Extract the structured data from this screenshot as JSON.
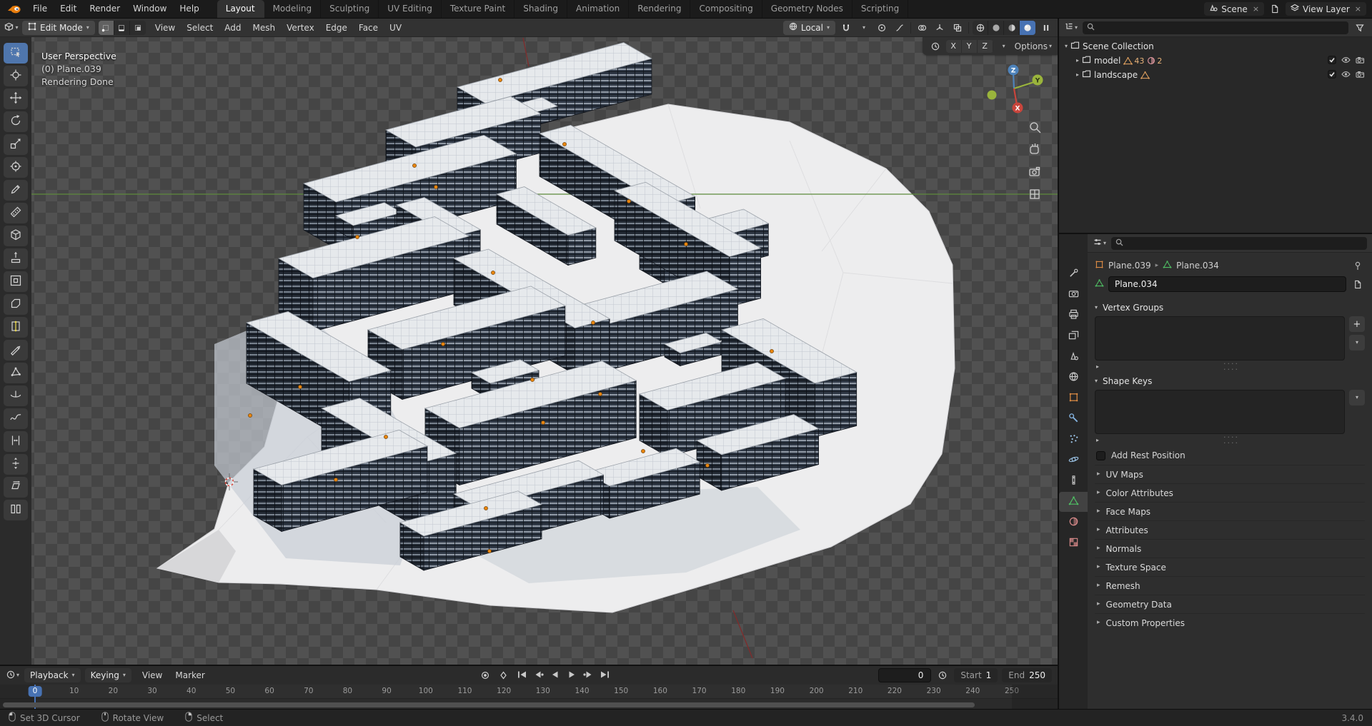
{
  "topbar": {
    "menus": [
      "File",
      "Edit",
      "Render",
      "Window",
      "Help"
    ],
    "workspaces": [
      "Layout",
      "Modeling",
      "Sculpting",
      "UV Editing",
      "Texture Paint",
      "Shading",
      "Animation",
      "Rendering",
      "Compositing",
      "Geometry Nodes",
      "Scripting"
    ],
    "active_workspace": "Layout",
    "scene_label": "Scene",
    "view_layer_label": "View Layer"
  },
  "viewport": {
    "mode": "Edit Mode",
    "menus": [
      "View",
      "Select",
      "Add",
      "Mesh",
      "Vertex",
      "Edge",
      "Face",
      "UV"
    ],
    "orientation": "Local",
    "options_label": "Options",
    "axis_toggles": [
      "X",
      "Y",
      "Z"
    ],
    "overlay": {
      "perspective": "User Perspective",
      "object": "(0) Plane.039",
      "status": "Rendering Done"
    },
    "gizmo": {
      "x": "X",
      "y": "Y",
      "z": "Z"
    }
  },
  "outliner": {
    "root": "Scene Collection",
    "items": [
      {
        "name": "model",
        "badges": [
          {
            "icon": "mesh",
            "count": "43"
          },
          {
            "icon": "material",
            "count": "2"
          }
        ]
      },
      {
        "name": "landscape",
        "badges": [
          {
            "icon": "mesh",
            "count": ""
          }
        ]
      }
    ]
  },
  "properties": {
    "tabs": [
      "tool",
      "render",
      "output",
      "view-layer",
      "scene",
      "world",
      "object",
      "modifiers",
      "particles",
      "physics",
      "constraints",
      "object-data",
      "material",
      "texture"
    ],
    "active_tab": "object-data",
    "breadcrumb_object": "Plane.039",
    "breadcrumb_data": "Plane.034",
    "name_value": "Plane.034",
    "vertex_groups_label": "Vertex Groups",
    "shape_keys_label": "Shape Keys",
    "add_rest_position_label": "Add Rest Position",
    "collapsed_panels": [
      "UV Maps",
      "Color Attributes",
      "Face Maps",
      "Attributes",
      "Normals",
      "Texture Space",
      "Remesh",
      "Geometry Data",
      "Custom Properties"
    ]
  },
  "timeline": {
    "playback_label": "Playback",
    "keying_label": "Keying",
    "menus": [
      "View",
      "Marker"
    ],
    "current_frame": "0",
    "start_label": "Start",
    "start_value": "1",
    "end_label": "End",
    "end_value": "250",
    "playhead_label": "0",
    "ticks": [
      0,
      10,
      20,
      30,
      40,
      50,
      60,
      70,
      80,
      90,
      100,
      110,
      120,
      130,
      140,
      150,
      160,
      170,
      180,
      190,
      200,
      210,
      220,
      230,
      240,
      250
    ]
  },
  "statusbar": {
    "hints": [
      {
        "button": "left",
        "label": "Set 3D Cursor"
      },
      {
        "button": "middle",
        "label": "Rotate View"
      },
      {
        "button": "right",
        "label": "Select"
      }
    ],
    "version": "3.4.0"
  },
  "colors": {
    "accent": "#4772b3",
    "orange": "#e8850f",
    "axis_x": "#c9453c",
    "axis_y": "#9ab43c",
    "axis_z": "#4e83bb"
  }
}
